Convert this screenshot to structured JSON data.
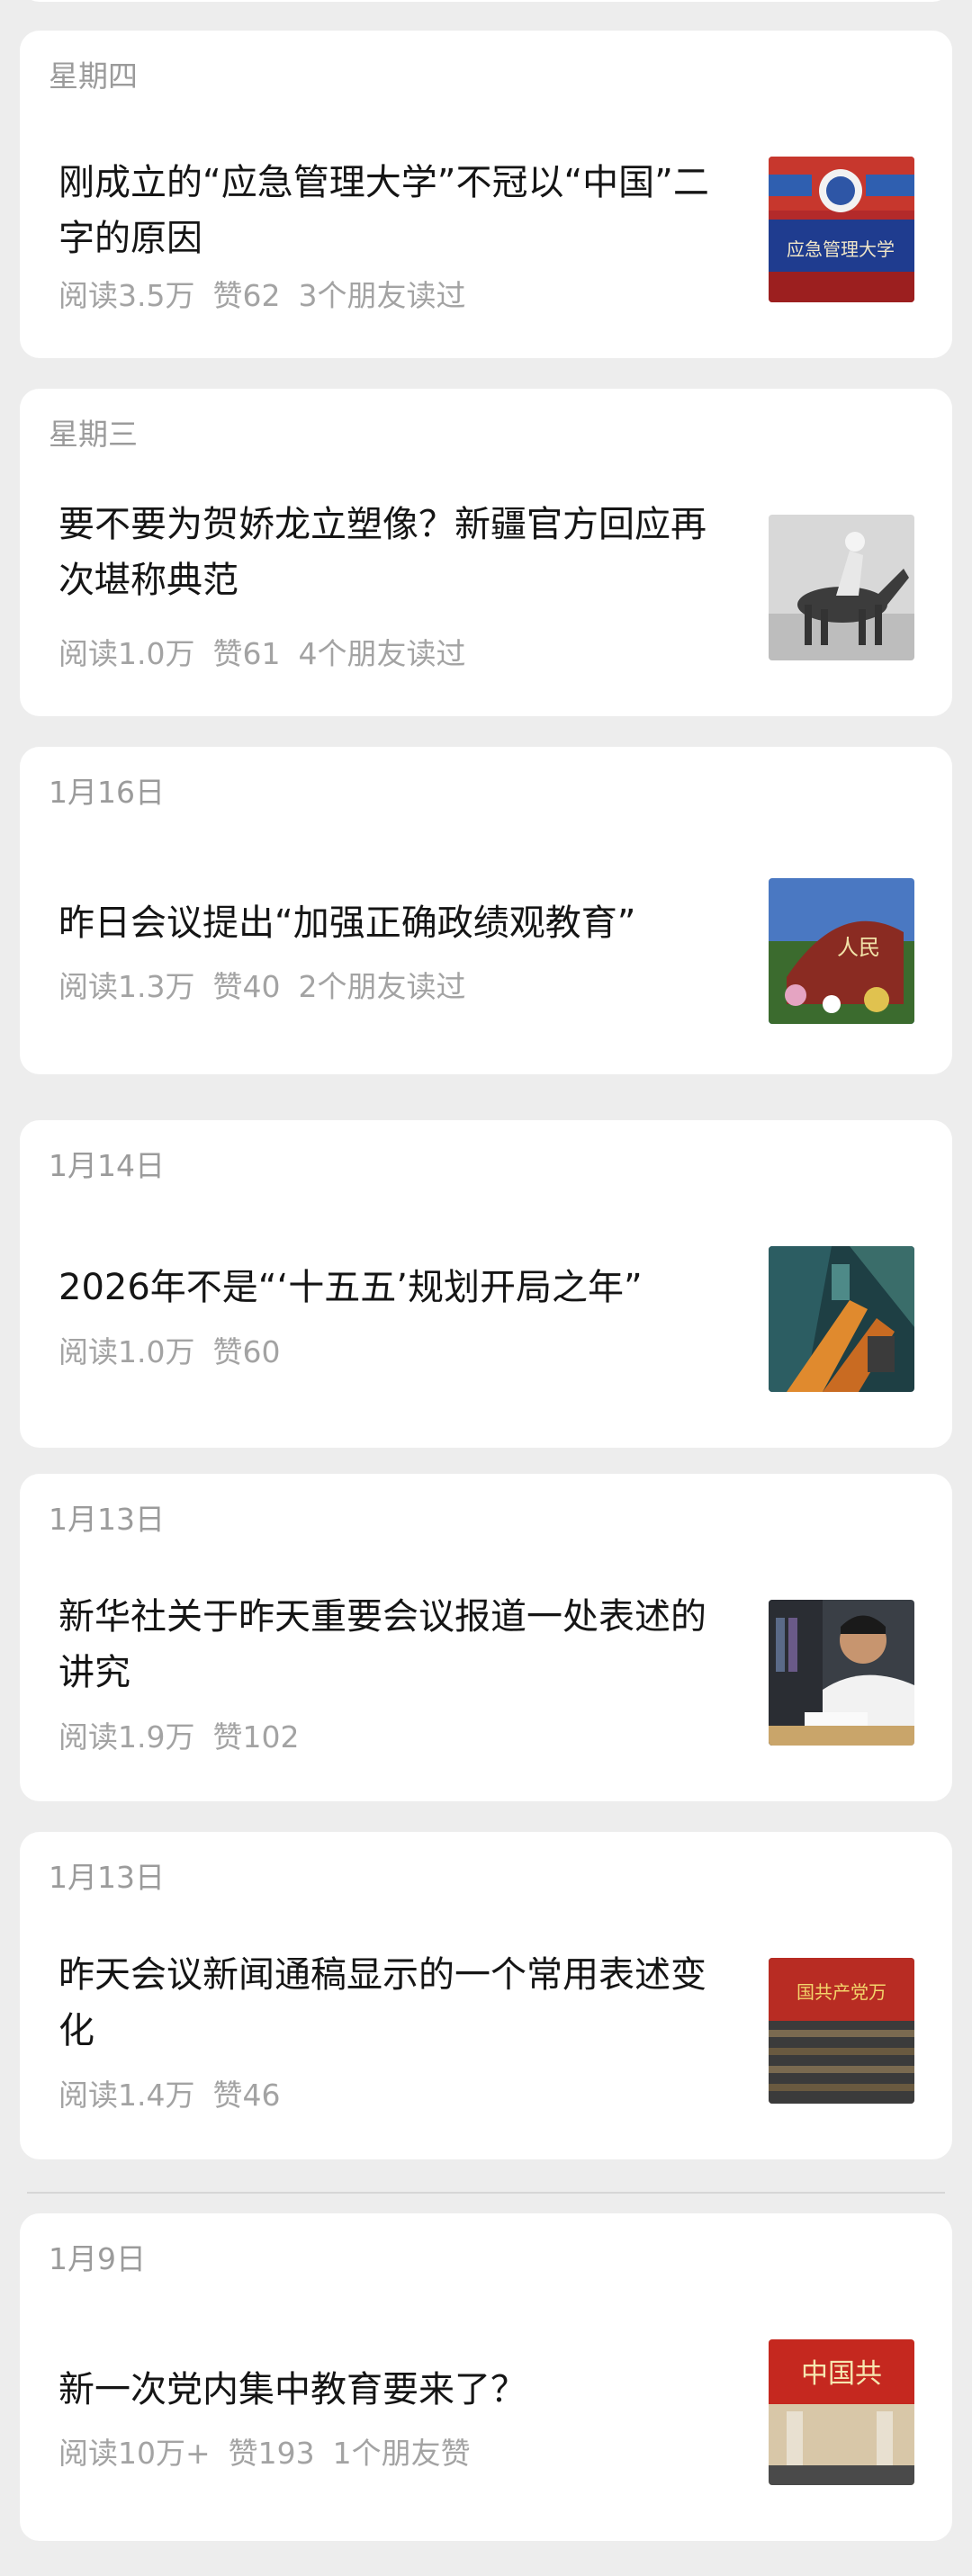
{
  "articles": [
    {
      "date": "星期四",
      "title": "刚成立的“应急管理大学”不冠以“中国”二字的原因",
      "reads": "阅读3.5万",
      "likes": "赞62",
      "social": "3个朋友读过",
      "thumb": "university-gate-photo"
    },
    {
      "date": "星期三",
      "title": "要不要为贺娇龙立塑像？新疆官方回应再次堪称典范",
      "reads": "阅读1.0万",
      "likes": "赞61",
      "social": "4个朋友读过",
      "thumb": "horse-rider-photo"
    },
    {
      "date": "1月16日",
      "title": "昨日会议提出“加强正确政绩观教育”",
      "reads": "阅读1.3万",
      "likes": "赞40",
      "social": "2个朋友读过",
      "thumb": "flower-display-photo"
    },
    {
      "date": "1月14日",
      "title": "2026年不是“‘十五五’规划开局之年”",
      "reads": "阅读1.0万",
      "likes": "赞60",
      "social": "",
      "thumb": "city-aerial-photo"
    },
    {
      "date": "1月13日",
      "title": "新华社关于昨天重要会议报道一处表述的讲究",
      "reads": "阅读1.9万",
      "likes": "赞102",
      "social": "",
      "thumb": "man-writing-photo"
    },
    {
      "date": "1月13日",
      "title": "昨天会议新闻通稿显示的一个常用表述变化",
      "reads": "阅读1.4万",
      "likes": "赞46",
      "social": "",
      "thumb": "meeting-hall-photo"
    },
    {
      "date": "1月9日",
      "title": "新一次党内集中教育要来了？",
      "reads": "阅读10万+",
      "likes": "赞193",
      "social": "1个朋友赞",
      "thumb": "banner-hall-photo"
    }
  ]
}
